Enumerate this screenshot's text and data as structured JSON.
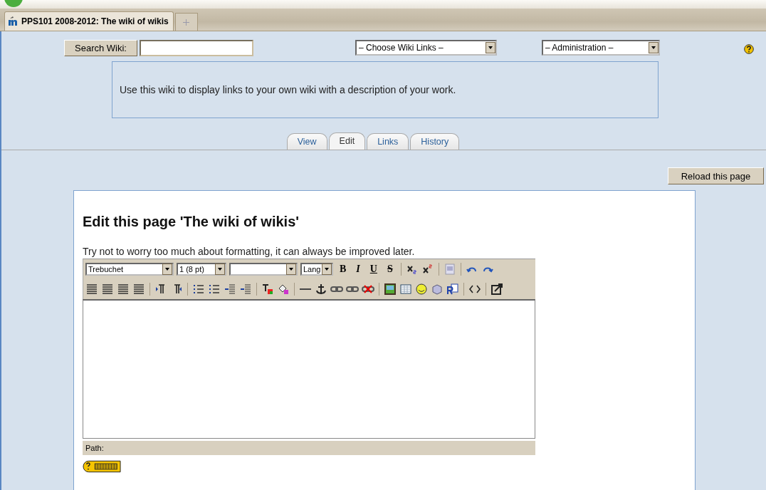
{
  "browser_tabs": [
    {
      "label": "PPS101 2008-2012: The wiki of wikis",
      "selected": true
    }
  ],
  "search": {
    "button": "Search Wiki:"
  },
  "selects": [
    {
      "value": "– Choose Wiki Links –"
    },
    {
      "value": "– Administration –"
    }
  ],
  "description": "Use this wiki to display links to your own wiki with a description of your work.",
  "tabs": [
    {
      "label": "View",
      "selected": false
    },
    {
      "label": "Edit",
      "selected": true
    },
    {
      "label": "Links",
      "selected": false
    },
    {
      "label": "History",
      "selected": false
    }
  ],
  "reload_button": "Reload this page",
  "heading": "Edit this page 'The wiki of wikis'",
  "hint": "Try not to worry too much about formatting, it can always be improved later.",
  "editor": {
    "font": "Trebuchet",
    "size": "1 (8 pt)",
    "lang": "Lang",
    "format_buttons": [
      "B",
      "I",
      "U",
      "S"
    ],
    "path_label": "Path:"
  }
}
